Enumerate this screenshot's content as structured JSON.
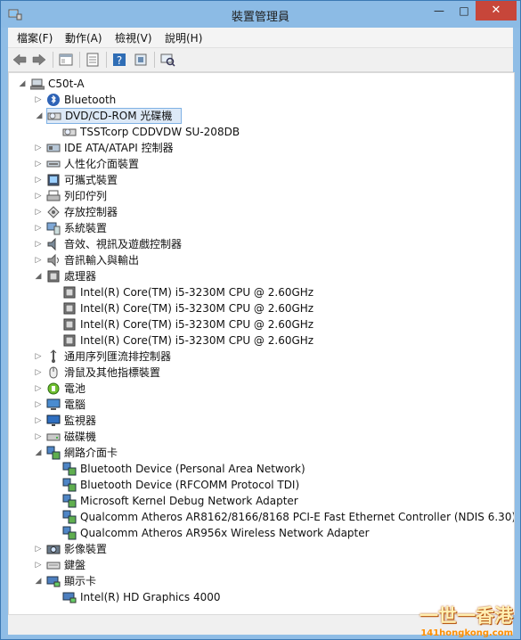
{
  "window": {
    "title": "裝置管理員",
    "controls": {
      "minimize": "—",
      "maximize": "□",
      "close": "✕"
    }
  },
  "menu": [
    "檔案(F)",
    "動作(A)",
    "檢視(V)",
    "說明(H)"
  ],
  "toolbar": {
    "buttons": [
      "back-arrow",
      "forward-arrow",
      "show-hide-console-tree",
      "properties",
      "help",
      "update-driver",
      "scan-hardware"
    ]
  },
  "tree": {
    "root": "C50t-A",
    "items": [
      {
        "label": "Bluetooth",
        "depth": 1,
        "state": "collapsed",
        "icon": "bluetooth-icon"
      },
      {
        "label": "DVD/CD-ROM 光碟機",
        "depth": 1,
        "state": "expanded",
        "icon": "dvd-drive-icon",
        "selected": true
      },
      {
        "label": "TSSTcorp CDDVDW SU-208DB",
        "depth": 2,
        "state": "leaf",
        "icon": "dvd-drive-icon"
      },
      {
        "label": "IDE ATA/ATAPI 控制器",
        "depth": 1,
        "state": "collapsed",
        "icon": "ide-controller-icon"
      },
      {
        "label": "人性化介面裝置",
        "depth": 1,
        "state": "collapsed",
        "icon": "hid-icon"
      },
      {
        "label": "可攜式裝置",
        "depth": 1,
        "state": "collapsed",
        "icon": "portable-device-icon"
      },
      {
        "label": "列印佇列",
        "depth": 1,
        "state": "collapsed",
        "icon": "printer-icon"
      },
      {
        "label": "存放控制器",
        "depth": 1,
        "state": "collapsed",
        "icon": "storage-controller-icon"
      },
      {
        "label": "系統裝置",
        "depth": 1,
        "state": "collapsed",
        "icon": "system-device-icon"
      },
      {
        "label": "音效、視訊及遊戲控制器",
        "depth": 1,
        "state": "collapsed",
        "icon": "sound-icon"
      },
      {
        "label": "音訊輸入與輸出",
        "depth": 1,
        "state": "collapsed",
        "icon": "audio-io-icon"
      },
      {
        "label": "處理器",
        "depth": 1,
        "state": "expanded",
        "icon": "processor-icon"
      },
      {
        "label": "Intel(R) Core(TM) i5-3230M CPU @ 2.60GHz",
        "depth": 2,
        "state": "leaf",
        "icon": "processor-icon"
      },
      {
        "label": "Intel(R) Core(TM) i5-3230M CPU @ 2.60GHz",
        "depth": 2,
        "state": "leaf",
        "icon": "processor-icon"
      },
      {
        "label": "Intel(R) Core(TM) i5-3230M CPU @ 2.60GHz",
        "depth": 2,
        "state": "leaf",
        "icon": "processor-icon"
      },
      {
        "label": "Intel(R) Core(TM) i5-3230M CPU @ 2.60GHz",
        "depth": 2,
        "state": "leaf",
        "icon": "processor-icon"
      },
      {
        "label": "通用序列匯流排控制器",
        "depth": 1,
        "state": "collapsed",
        "icon": "usb-icon"
      },
      {
        "label": "滑鼠及其他指標裝置",
        "depth": 1,
        "state": "collapsed",
        "icon": "mouse-icon"
      },
      {
        "label": "電池",
        "depth": 1,
        "state": "collapsed",
        "icon": "battery-icon"
      },
      {
        "label": "電腦",
        "depth": 1,
        "state": "collapsed",
        "icon": "computer-icon"
      },
      {
        "label": "監視器",
        "depth": 1,
        "state": "collapsed",
        "icon": "monitor-icon"
      },
      {
        "label": "磁碟機",
        "depth": 1,
        "state": "collapsed",
        "icon": "disk-drive-icon"
      },
      {
        "label": "網路介面卡",
        "depth": 1,
        "state": "expanded",
        "icon": "network-adapter-icon"
      },
      {
        "label": "Bluetooth Device (Personal Area Network)",
        "depth": 2,
        "state": "leaf",
        "icon": "network-adapter-icon"
      },
      {
        "label": "Bluetooth Device (RFCOMM Protocol TDI)",
        "depth": 2,
        "state": "leaf",
        "icon": "network-adapter-icon"
      },
      {
        "label": "Microsoft Kernel Debug Network Adapter",
        "depth": 2,
        "state": "leaf",
        "icon": "network-adapter-icon"
      },
      {
        "label": "Qualcomm Atheros AR8162/8166/8168 PCI-E Fast Ethernet Controller (NDIS 6.30)",
        "depth": 2,
        "state": "leaf",
        "icon": "network-adapter-icon"
      },
      {
        "label": "Qualcomm Atheros AR956x Wireless Network Adapter",
        "depth": 2,
        "state": "leaf",
        "icon": "network-adapter-icon"
      },
      {
        "label": "影像裝置",
        "depth": 1,
        "state": "collapsed",
        "icon": "imaging-device-icon"
      },
      {
        "label": "鍵盤",
        "depth": 1,
        "state": "collapsed",
        "icon": "keyboard-icon"
      },
      {
        "label": "顯示卡",
        "depth": 1,
        "state": "expanded",
        "icon": "display-adapter-icon"
      },
      {
        "label": "Intel(R) HD Graphics 4000",
        "depth": 2,
        "state": "leaf",
        "icon": "display-adapter-icon"
      }
    ]
  },
  "watermark": {
    "line1": "一世一香港",
    "line2": "141hongkong.com"
  }
}
